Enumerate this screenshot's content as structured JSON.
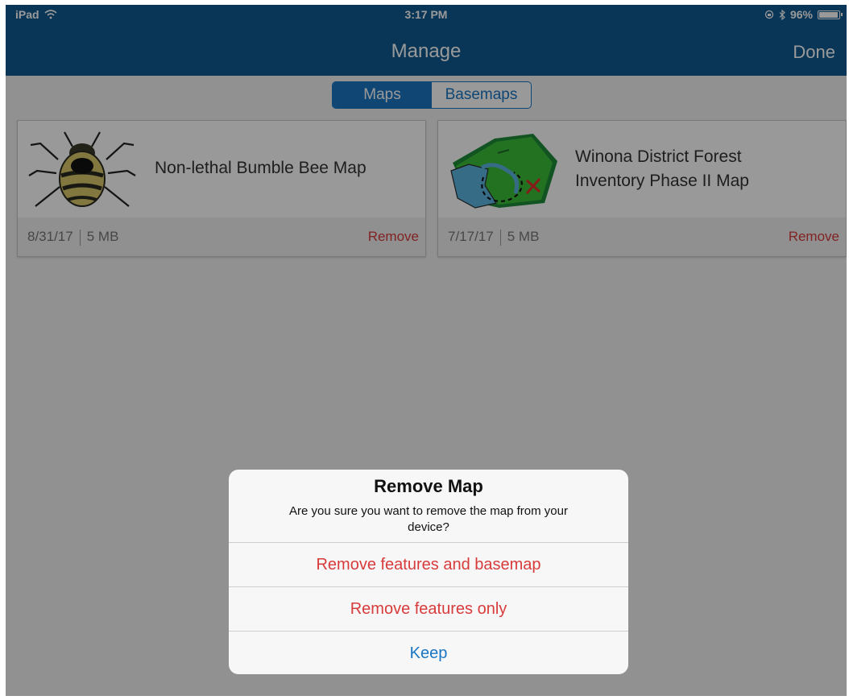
{
  "status_bar": {
    "device": "iPad",
    "time": "3:17 PM",
    "battery": "96%",
    "battery_level": 0.96
  },
  "nav": {
    "title": "Manage",
    "done_label": "Done"
  },
  "segments": {
    "maps_label": "Maps",
    "basemaps_label": "Basemaps",
    "selected": "Maps"
  },
  "maps": [
    {
      "name": "Non-lethal Bumble Bee Map",
      "date": "8/31/17",
      "size": "5 MB",
      "remove_label": "Remove",
      "thumbnail": "bumble-bee-illustration"
    },
    {
      "name_line1": "Winona District Forest",
      "name_line2": "Inventory Phase II Map",
      "date": "7/17/17",
      "size": "5 MB",
      "remove_label": "Remove",
      "thumbnail": "forest-map-illustration"
    }
  ],
  "dialog": {
    "title": "Remove Map",
    "message_line1": "Are you sure you want to remove the map from your",
    "message_line2": "device?",
    "buttons": {
      "remove_all": "Remove features and basemap",
      "remove_features": "Remove features only",
      "keep": "Keep"
    }
  },
  "colors": {
    "brand": "#0f5b91",
    "accent": "#1a75c2",
    "destructive": "#d83b3b"
  }
}
